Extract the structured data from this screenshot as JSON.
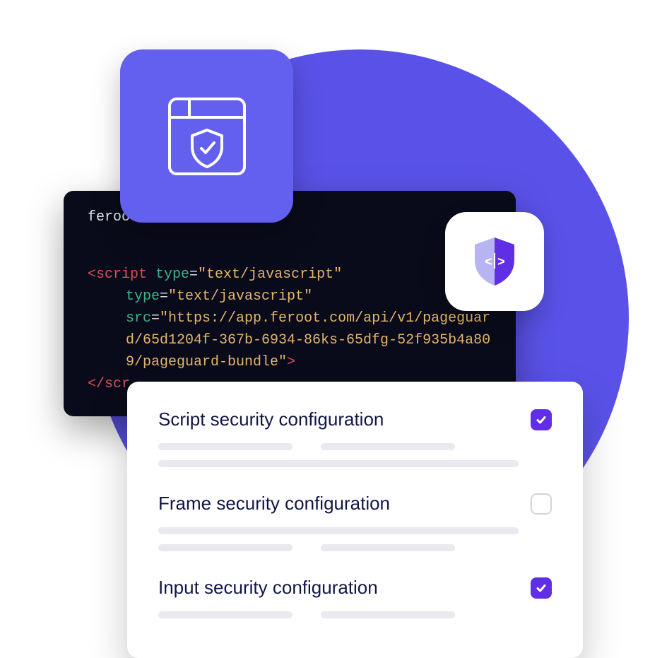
{
  "code": {
    "label": "feroot:",
    "script_open": "<script",
    "type_attr": "type",
    "type_val": "\"text/javascript\"",
    "src_attr": "src",
    "src_val": "\"https://app.feroot.com/api/v1/pageguard/65d1204f-367b-6934-86ks-65dfg-52f935b4a809/pageguard-bundle\"",
    "close_angle": ">",
    "script_close": "</scr"
  },
  "config": {
    "items": [
      {
        "title": "Script security configuration",
        "checked": true
      },
      {
        "title": "Frame security configuration",
        "checked": false
      },
      {
        "title": "Input security configuration",
        "checked": true
      }
    ]
  },
  "colors": {
    "accent": "#5f2ee5",
    "circle": "#5a52e8",
    "card": "#6360f0"
  }
}
